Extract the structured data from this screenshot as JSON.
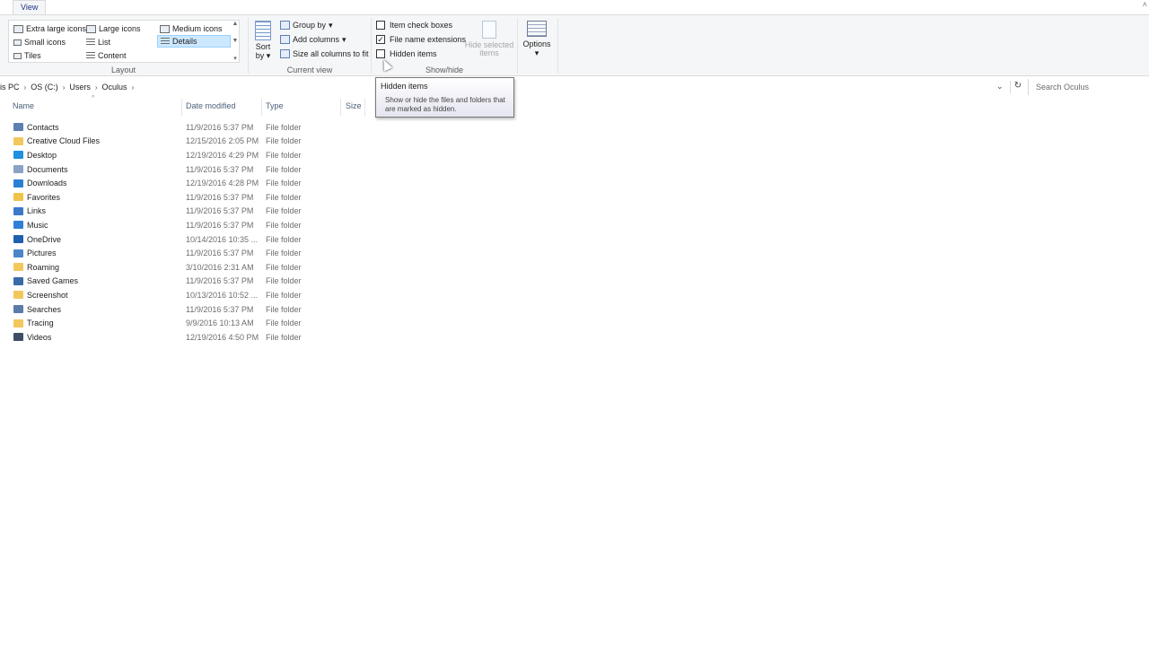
{
  "tabbar": {
    "active_tab": "View"
  },
  "ribbon": {
    "layout": {
      "label": "Layout",
      "items": [
        {
          "label": "Extra large icons",
          "selected": false
        },
        {
          "label": "Large icons",
          "selected": false
        },
        {
          "label": "Medium icons",
          "selected": false
        },
        {
          "label": "Small icons",
          "selected": false
        },
        {
          "label": "List",
          "selected": false
        },
        {
          "label": "Details",
          "selected": true
        },
        {
          "label": "Tiles",
          "selected": false
        },
        {
          "label": "Content",
          "selected": false
        }
      ]
    },
    "current_view": {
      "label": "Current view",
      "sort_label": "Sort",
      "sort_by": "by",
      "group_by": "Group by",
      "add_columns": "Add columns",
      "size_all": "Size all columns to fit"
    },
    "show_hide": {
      "label": "Show/hide",
      "item_check_boxes": {
        "label": "Item check boxes",
        "checked": false
      },
      "file_name_extensions": {
        "label": "File name extensions",
        "checked": true
      },
      "hidden_items": {
        "label": "Hidden items",
        "checked": false
      },
      "hide_selected_line1": "Hide selected",
      "hide_selected_line2": "items"
    },
    "options": {
      "label": "Options"
    }
  },
  "address": {
    "crumbs": [
      "is PC",
      "OS (C:)",
      "Users",
      "Oculus"
    ],
    "search_placeholder": "Search Oculus"
  },
  "columns": {
    "name": "Name",
    "date": "Date modified",
    "type": "Type",
    "size": "Size"
  },
  "rows": [
    {
      "name": "Contacts",
      "date": "11/9/2016 5:37 PM",
      "type": "File folder",
      "icon": "contacts-icon",
      "color": "#5b7fb1"
    },
    {
      "name": "Creative Cloud Files",
      "date": "12/15/2016 2:05 PM",
      "type": "File folder",
      "icon": "folder-icon",
      "color": "#f2c75c"
    },
    {
      "name": "Desktop",
      "date": "12/19/2016 4:29 PM",
      "type": "File folder",
      "icon": "desktop-icon",
      "color": "#1e90e0"
    },
    {
      "name": "Documents",
      "date": "11/9/2016 5:37 PM",
      "type": "File folder",
      "icon": "documents-icon",
      "color": "#8aa3c4"
    },
    {
      "name": "Downloads",
      "date": "12/19/2016 4:28 PM",
      "type": "File folder",
      "icon": "downloads-icon",
      "color": "#2a7fd4"
    },
    {
      "name": "Favorites",
      "date": "11/9/2016 5:37 PM",
      "type": "File folder",
      "icon": "favorites-icon",
      "color": "#f0c34a"
    },
    {
      "name": "Links",
      "date": "11/9/2016 5:37 PM",
      "type": "File folder",
      "icon": "links-icon",
      "color": "#3c78c8"
    },
    {
      "name": "Music",
      "date": "11/9/2016 5:37 PM",
      "type": "File folder",
      "icon": "music-icon",
      "color": "#2f7ed8"
    },
    {
      "name": "OneDrive",
      "date": "10/14/2016 10:35 ...",
      "type": "File folder",
      "icon": "onedrive-icon",
      "color": "#1f5fae"
    },
    {
      "name": "Pictures",
      "date": "11/9/2016 5:37 PM",
      "type": "File folder",
      "icon": "pictures-icon",
      "color": "#4a86c8"
    },
    {
      "name": "Roaming",
      "date": "3/10/2016 2:31 AM",
      "type": "File folder",
      "icon": "folder-icon",
      "color": "#f2c75c"
    },
    {
      "name": "Saved Games",
      "date": "11/9/2016 5:37 PM",
      "type": "File folder",
      "icon": "saved-games-icon",
      "color": "#3a6aa8"
    },
    {
      "name": "Screenshot",
      "date": "10/13/2016 10:52 ...",
      "type": "File folder",
      "icon": "folder-icon",
      "color": "#f2c75c"
    },
    {
      "name": "Searches",
      "date": "11/9/2016 5:37 PM",
      "type": "File folder",
      "icon": "searches-icon",
      "color": "#5a7ca8"
    },
    {
      "name": "Tracing",
      "date": "9/9/2016 10:13 AM",
      "type": "File folder",
      "icon": "folder-icon",
      "color": "#f2c75c"
    },
    {
      "name": "Videos",
      "date": "12/19/2016 4:50 PM",
      "type": "File folder",
      "icon": "videos-icon",
      "color": "#3d4e66"
    }
  ],
  "tooltip": {
    "title": "Hidden items",
    "body": "Show or hide the files and folders that are marked as hidden."
  }
}
